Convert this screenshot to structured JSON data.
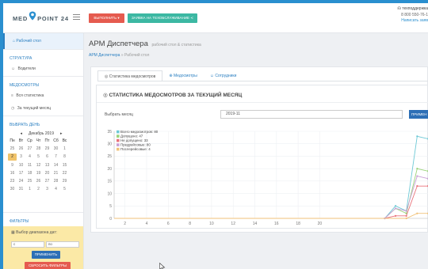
{
  "header": {
    "logo_left": "MED",
    "logo_right": "POINT 24",
    "btn_action": "ВЫПОЛНИТЬ",
    "btn_request": "ЗАЯВКА НА ТЕХОБСЛУЖИВАНИЕ",
    "support_title": "техподдержка",
    "support_phone": "8 800 550-76-1",
    "support_link": "Написать заяв"
  },
  "sidebar": {
    "top_item": "Рабочий стол",
    "section_structure": "СТРУКТУРА",
    "item_drivers": "Водители",
    "section_checks": "МЕДОСМОТРЫ",
    "item_all_stats": "Вся статистика",
    "item_month": "За текущий месяц",
    "section_day": "ВЫБРАТЬ ДЕНЬ",
    "calendar": {
      "month_label": "Декабрь 2019",
      "weekdays": [
        "Пн",
        "Вт",
        "Ср",
        "Чт",
        "Пт",
        "Сб",
        "Вс"
      ],
      "days": [
        "25",
        "26",
        "27",
        "28",
        "29",
        "30",
        "1",
        "2",
        "3",
        "4",
        "5",
        "6",
        "7",
        "8",
        "9",
        "10",
        "11",
        "12",
        "13",
        "14",
        "15",
        "16",
        "17",
        "18",
        "19",
        "20",
        "21",
        "22",
        "23",
        "24",
        "25",
        "26",
        "27",
        "28",
        "29",
        "30",
        "31",
        "1",
        "2",
        "3",
        "4",
        "5"
      ],
      "selected_index": 7
    },
    "section_filters": "ФИЛЬТРЫ",
    "range_label": "Выбор диапазона дат:",
    "from_prefix": "с",
    "to_prefix": "по",
    "btn_apply": "ПРИМЕНИТЬ",
    "btn_reset": "СБРОСИТЬ ФИЛЬТРЫ"
  },
  "main": {
    "title": "АРМ Диспетчера",
    "subtitle": "рабочий стол & статистика",
    "crumb_link": "АРМ Диспетчера",
    "crumb_sep": "»",
    "crumb_current": "Рабочий стол",
    "tabs": [
      "Статистика медосмотров",
      "Медосмотры",
      "Сотрудники"
    ],
    "section_title": "СТАТИСТИКА МЕДОСМОТРОВ ЗА ТЕКУЩИЙ МЕСЯЦ",
    "month_label": "Выбрать месяц",
    "month_value": "2019-11",
    "btn_apply": "ПРИМЕН"
  },
  "chart_data": {
    "type": "line",
    "x": [
      1,
      2,
      3,
      4,
      5,
      6,
      7,
      8,
      9,
      10,
      11,
      12,
      13,
      14,
      15,
      16,
      17,
      18,
      19,
      20,
      21,
      22,
      23,
      24,
      25,
      26,
      27,
      28,
      29,
      30
    ],
    "x_ticks": [
      2,
      4,
      6,
      8,
      10,
      12,
      14,
      16,
      18,
      20
    ],
    "y_ticks": [
      0,
      5,
      10,
      15,
      20,
      25,
      30,
      35
    ],
    "ylim": [
      0,
      35
    ],
    "legend_position": "top-left",
    "series": [
      {
        "name": "Всего медосмотров: 80",
        "color": "#6ec9d6",
        "values": [
          0,
          0,
          0,
          0,
          0,
          0,
          0,
          0,
          0,
          0,
          0,
          0,
          0,
          0,
          0,
          0,
          0,
          0,
          0,
          0,
          0,
          0,
          0,
          0,
          0,
          0,
          5,
          3,
          33,
          32
        ]
      },
      {
        "name": "Допущено: 47",
        "color": "#9bd37a",
        "values": [
          0,
          0,
          0,
          0,
          0,
          0,
          0,
          0,
          0,
          0,
          0,
          0,
          0,
          0,
          0,
          0,
          0,
          0,
          0,
          0,
          0,
          0,
          0,
          0,
          0,
          0,
          4,
          2,
          20,
          19
        ]
      },
      {
        "name": "Не допущено: 33",
        "color": "#e9717a",
        "values": [
          0,
          0,
          0,
          0,
          0,
          0,
          0,
          0,
          0,
          0,
          0,
          0,
          0,
          0,
          0,
          0,
          0,
          0,
          0,
          0,
          0,
          0,
          0,
          0,
          0,
          0,
          1,
          1,
          13,
          13
        ]
      },
      {
        "name": "Предрейсовые: 80",
        "color": "#c9a0d6",
        "values": [
          0,
          0,
          0,
          0,
          0,
          0,
          0,
          0,
          0,
          0,
          0,
          0,
          0,
          0,
          0,
          0,
          0,
          0,
          0,
          0,
          0,
          0,
          0,
          0,
          0,
          0,
          4,
          3,
          17,
          16
        ]
      },
      {
        "name": "Послерейсовые: 4",
        "color": "#f1c27a",
        "values": [
          0,
          0,
          0,
          0,
          0,
          0,
          0,
          0,
          0,
          0,
          0,
          0,
          0,
          0,
          0,
          0,
          0,
          0,
          0,
          0,
          0,
          0,
          0,
          0,
          0,
          0,
          0,
          0,
          2,
          2
        ]
      }
    ]
  },
  "colors": {
    "accent": "#2a7fc1",
    "danger": "#e55b4f",
    "teal": "#3cb8a3",
    "filter_bg": "#fbe9a6",
    "frame": "#2a8fcf"
  }
}
